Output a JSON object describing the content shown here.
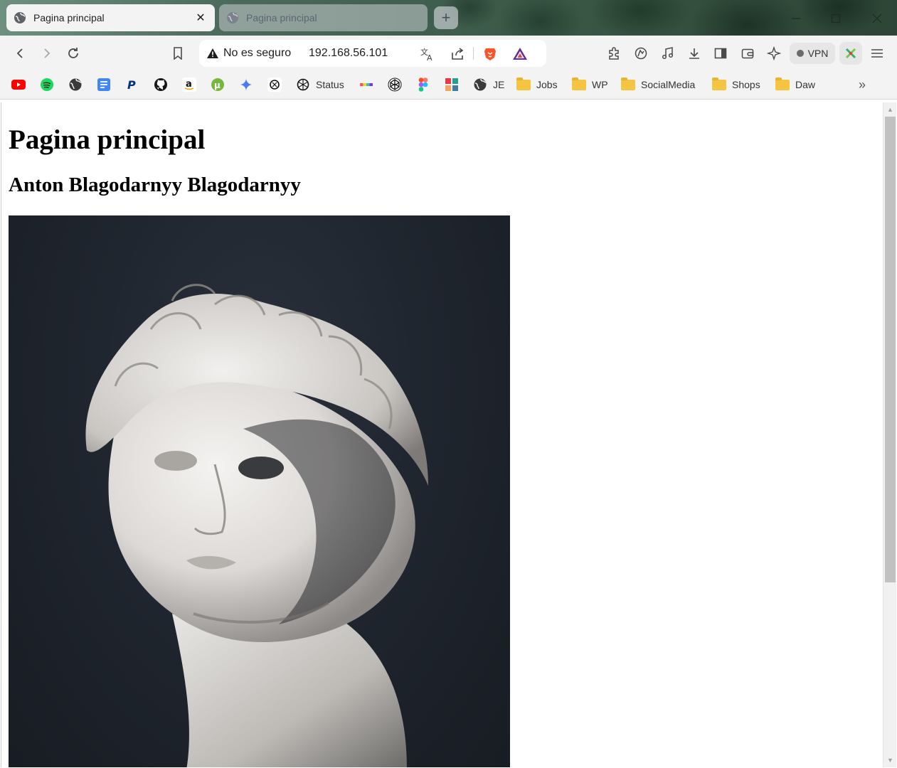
{
  "tabs": [
    {
      "label": "Pagina principal",
      "active": true
    },
    {
      "label": "Pagina principal",
      "active": false
    }
  ],
  "new_tab_symbol": "+",
  "window_controls": {
    "minimize": "—",
    "maximize": "☐",
    "close": "✕"
  },
  "address_bar": {
    "security_label": "No es seguro",
    "url": "192.168.56.101"
  },
  "vpn_label": "VPN",
  "bookmarks": [
    {
      "icon": "youtube-icon",
      "label": ""
    },
    {
      "icon": "spotify-icon",
      "label": ""
    },
    {
      "icon": "globe-icon",
      "label": ""
    },
    {
      "icon": "docs-icon",
      "label": ""
    },
    {
      "icon": "paypal-icon",
      "label": ""
    },
    {
      "icon": "github-icon",
      "label": ""
    },
    {
      "icon": "amazon-icon",
      "label": ""
    },
    {
      "icon": "utorrent-icon",
      "label": ""
    },
    {
      "icon": "gemini-icon",
      "label": ""
    },
    {
      "icon": "chatgpt-icon",
      "label": ""
    },
    {
      "icon": "openai-icon",
      "label": "Status"
    },
    {
      "icon": "colorbar-icon",
      "label": ""
    },
    {
      "icon": "codepen-icon",
      "label": ""
    },
    {
      "icon": "figma-icon",
      "label": ""
    },
    {
      "icon": "puzzle-color-icon",
      "label": ""
    },
    {
      "icon": "globe-icon",
      "label": "JE"
    },
    {
      "icon": "folder-icon",
      "label": "Jobs"
    },
    {
      "icon": "folder-icon",
      "label": "WP"
    },
    {
      "icon": "folder-icon",
      "label": "SocialMedia"
    },
    {
      "icon": "folder-icon",
      "label": "Shops"
    },
    {
      "icon": "folder-icon",
      "label": "Daw"
    }
  ],
  "overflow_symbol": "»",
  "page": {
    "title": "Pagina principal",
    "author": "Anton Blagodarnyy Blagodarnyy",
    "image_description": "statue-bust-photo"
  },
  "colors": {
    "toolbar_bg": "#f3f3f3",
    "photo_bg": "#20262f",
    "statue": "#e8e6e4"
  }
}
